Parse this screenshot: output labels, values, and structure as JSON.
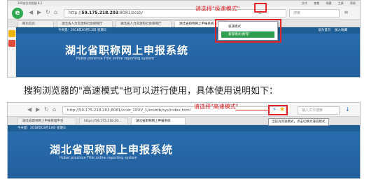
{
  "screenshot1": {
    "title": "360安全浏览器 8.1",
    "menu_items": [
      "文件",
      "查看",
      "收藏",
      "工具",
      "帮助"
    ],
    "url_host": "59.175.218.203",
    "url_path": ":8081/zcsb/",
    "search_placeholder": "搜索",
    "tabs": [
      "网页首页",
      "湖北省人力资源和社会保障厅",
      "湖北省人力资源和社会保障厅",
      "湖北省职称网上申报系统"
    ],
    "annotation": "请选择\"极速模式\"",
    "dropdown_items": [
      "极速模式",
      "兼容模式(推荐)"
    ],
    "date_text": "今天是：2018年03月13日  星期三",
    "right_links": [
      "设为首页",
      "加入收藏"
    ],
    "site_title": "湖北省职称网上申报系统",
    "site_subtitle": "Hubei province Title online reporting system"
  },
  "caption": "搜狗浏览器的\"高速模式\"也可以进行使用，具体使用说明如下：",
  "screenshot2": {
    "url": "http://59.175.218.203:8081/zcsb_10UV_1/zcsbtb/sys/index.html",
    "search_placeholder": "输入文字搜索",
    "tabs": [
      "湖北省职称网上申报管理平台",
      "https://59.175.218.20...",
      "湖北省职称网上申报系统"
    ],
    "annotation": "请选择\"高速模式\"",
    "tooltip": "当前为高速模式，点击切换为兼容模式",
    "date_text": "今天是：2018年03月13日  星期三",
    "site_title": "湖北省职称网上申报系统",
    "site_subtitle": "Hubei province Title online reporting system"
  }
}
